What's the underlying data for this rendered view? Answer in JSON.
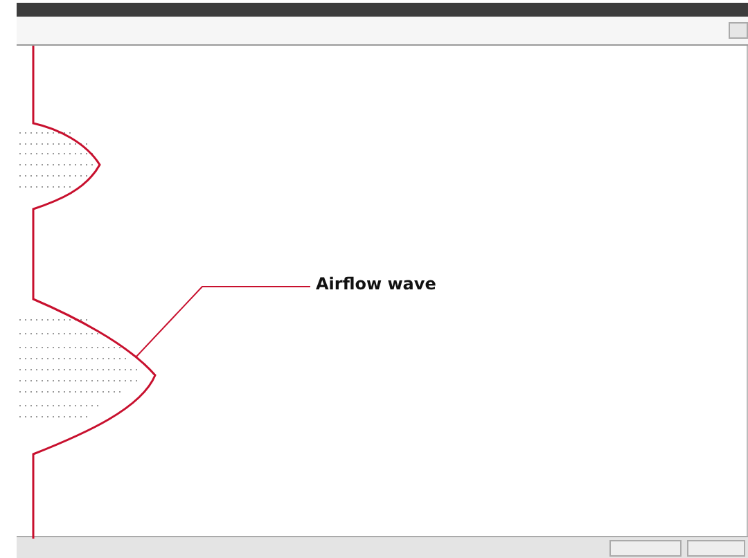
{
  "annotation": {
    "label": "Airflow wave"
  }
}
